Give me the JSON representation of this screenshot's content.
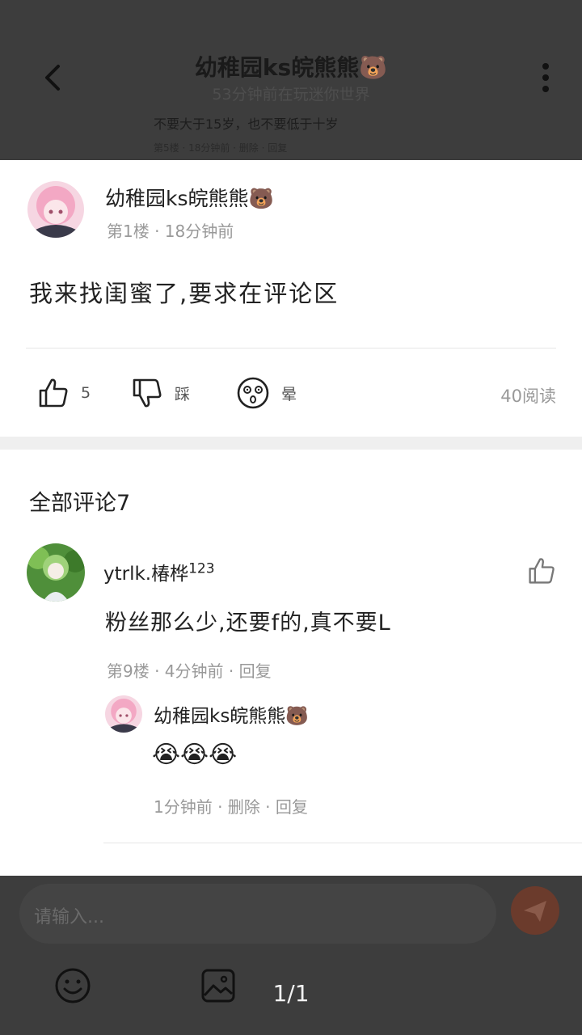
{
  "header": {
    "title": "幼稚园ks皖熊熊🐻",
    "subtitle": "53分钟前在玩迷你世界"
  },
  "background_snippet": {
    "line1": "不要大于15岁，也不要低于十岁",
    "line2": "第5楼 · 18分钟前 · 删除 · 回复"
  },
  "post": {
    "author": "幼稚园ks皖熊熊🐻",
    "meta": "第1楼 · 18分钟前",
    "body": "我来找闺蜜了,要求在评论区",
    "actions": {
      "like_count": "5",
      "dislike_label": "踩",
      "dizzy_label": "晕"
    },
    "reads": "40阅读"
  },
  "comments": {
    "title": "全部评论7",
    "items": [
      {
        "author": "ytrlk.椿桦",
        "author_sup": "123",
        "body": "粉丝那么少,还要f的,真不要L",
        "meta": "第9楼 · 4分钟前 · 回复",
        "reply": {
          "author": "幼稚园ks皖熊熊🐻",
          "body": "😭😭😭",
          "meta": "1分钟前 · 删除 · 回复"
        }
      }
    ]
  },
  "input": {
    "placeholder": "请输入..."
  },
  "pager": "1/1",
  "colors": {
    "overlay": "#3d3d3d",
    "sheet": "#ffffff",
    "meta_text": "#999999",
    "send_button": "#6b3b2c"
  },
  "icons": [
    "back-arrow-icon",
    "more-vertical-icon",
    "thumbs-up-icon",
    "thumbs-down-icon",
    "dizzy-face-icon",
    "smiley-icon",
    "image-icon",
    "send-icon"
  ]
}
